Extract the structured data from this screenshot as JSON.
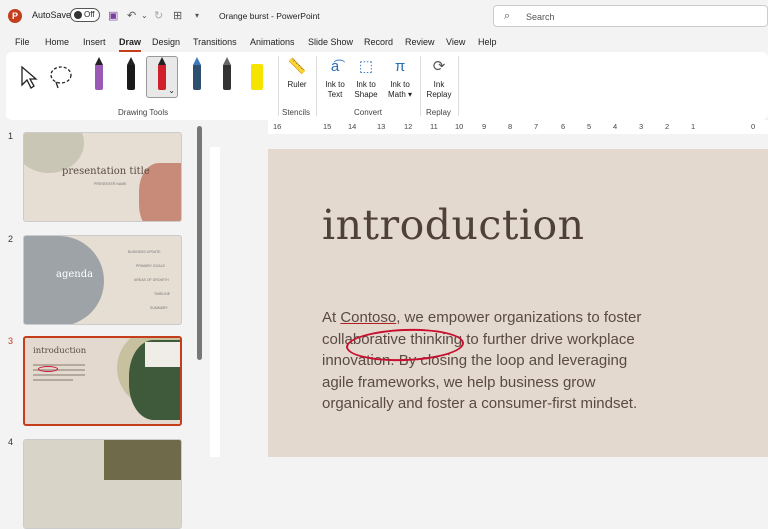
{
  "titlebar": {
    "autosave_label": "AutoSave",
    "autosave_state": "Off",
    "doc_title": "Orange burst",
    "app_sep": " - ",
    "app_name": "PowerPoint",
    "search_placeholder": "Search"
  },
  "tabs": [
    "File",
    "Home",
    "Insert",
    "Draw",
    "Design",
    "Transitions",
    "Animations",
    "Slide Show",
    "Record",
    "Review",
    "View",
    "Help"
  ],
  "ribbon": {
    "groups": {
      "drawing_tools": "Drawing Tools",
      "stencils": "Stencils",
      "convert": "Convert",
      "replay": "Replay"
    },
    "buttons": {
      "ruler": "Ruler",
      "ink_to_text": [
        "Ink to",
        "Text"
      ],
      "ink_to_shape": [
        "Ink to",
        "Shape"
      ],
      "ink_to_math": [
        "Ink to",
        "Math ▾"
      ],
      "ink_replay": [
        "Ink",
        "Replay"
      ]
    },
    "pens": [
      {
        "name": "pen-purple",
        "color": "#9b59b6"
      },
      {
        "name": "pen-black",
        "color": "#1a1a1a"
      },
      {
        "name": "pen-red",
        "color": "#d01f2a"
      },
      {
        "name": "pen-galaxy",
        "color": "#2f4f6f"
      },
      {
        "name": "pen-gray",
        "color": "#333333"
      },
      {
        "name": "highlighter-yellow",
        "color": "#f5e400"
      }
    ]
  },
  "ruler_ticks": [
    "16",
    "15",
    "14",
    "13",
    "12",
    "11",
    "10",
    "9",
    "8",
    "7",
    "6",
    "5",
    "4",
    "3",
    "2",
    "1",
    "0"
  ],
  "thumbnails": [
    {
      "number": "1",
      "title": "presentation title",
      "subtitle": "PRESENTER NAME"
    },
    {
      "number": "2",
      "title": "agenda",
      "items": [
        "BUSINESS UPDATE",
        "PRIMARY GOALS",
        "AREAS OF GROWTH",
        "TIMELINE",
        "SUMMARY"
      ]
    },
    {
      "number": "3",
      "title": "introduction"
    },
    {
      "number": "4"
    }
  ],
  "slide": {
    "title": "introduction",
    "body_pre": "At ",
    "body_underlined": "Contoso",
    "body_post": ", we empower organizations to foster collaborative thinking to further drive workplace innovation. By closing the loop and leveraging agile frameworks, we help business grow organically and foster a consumer-first mindset."
  },
  "colors": {
    "accent": "#c43e1c",
    "ink_red": "#c8102e",
    "slide_bg": "#e3d9cf",
    "text_brown": "#4f4039"
  }
}
